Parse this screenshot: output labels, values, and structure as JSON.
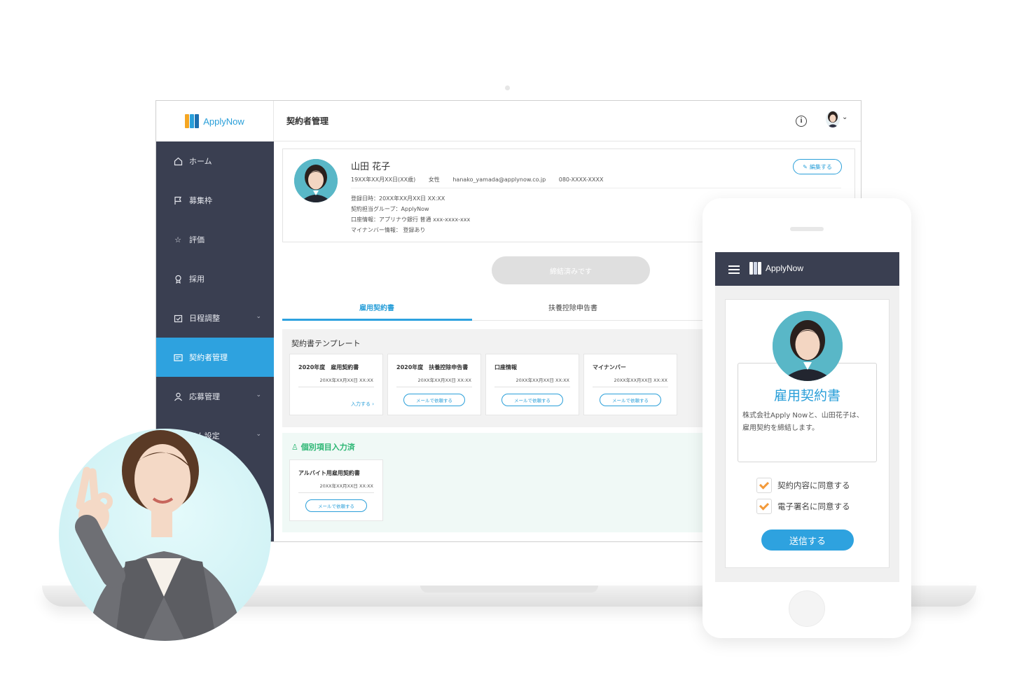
{
  "colors": {
    "accent": "#2ea2df",
    "sidebar": "#3a3f51",
    "success": "#2bb673",
    "check": "#f39a3a"
  },
  "app": {
    "brand": "ApplyNow",
    "page_title": "契約者管理"
  },
  "sidebar": {
    "items": [
      {
        "label": "ホーム",
        "icon": "home-icon"
      },
      {
        "label": "募集枠",
        "icon": "flag-icon"
      },
      {
        "label": "評価",
        "icon": "star-icon"
      },
      {
        "label": "採用",
        "icon": "ribbon-icon"
      },
      {
        "label": "日程調整",
        "icon": "calendar-icon"
      },
      {
        "label": "契約者管理",
        "icon": "id-card-icon"
      },
      {
        "label": "応募管理",
        "icon": "person-icon"
      },
      {
        "label": "テム設定",
        "icon": "settings-icon"
      }
    ]
  },
  "profile": {
    "name": "山田 花子",
    "birth": "19XX年XX月XX日(XX歳)",
    "gender": "女性",
    "email": "hanako_yamada@applynow.co.jp",
    "phone": "080-XXXX-XXXX",
    "registered": "登録日時：20XX年XX月XX日 XX:XX",
    "group": "契約担当グループ：ApplyNow",
    "bank": "口座情報：アプリナウ銀行 普通 xxx-xxxx-xxx",
    "mynumber": "マイナンバー情報： 登録あり",
    "edit_label": "編集する"
  },
  "status_button": "締結済みです",
  "tabs": [
    {
      "label": "雇用契約書"
    },
    {
      "label": "扶養控除申告書"
    }
  ],
  "templates": {
    "title": "契約書テンプレート",
    "cards": [
      {
        "title": "2020年度　雇用契約書",
        "date": "20XX年XX月XX日 XX:XX",
        "action": "入力する ›"
      },
      {
        "title": "2020年度　扶養控除申告書",
        "date": "20XX年XX月XX日 XX:XX",
        "action": "メールで依頼する"
      },
      {
        "title": "口座情報",
        "date": "20XX年XX月XX日 XX:XX",
        "action": "メールで依頼する"
      },
      {
        "title": "マイナンバー",
        "date": "20XX年XX月XX日 XX:XX",
        "action": "メールで依頼する"
      }
    ]
  },
  "individual": {
    "title": "個別項目入力済",
    "card": {
      "title": "アルバイト用雇用契約書",
      "date": "20XX年XX月XX日 XX:XX",
      "action": "メールで依頼する"
    }
  },
  "phone": {
    "brand": "ApplyNow",
    "title": "雇用契約書",
    "description": "株式会社Apply Nowと、山田花子は、雇用契約を締結します。",
    "checks": [
      "契約内容に同意する",
      "電子署名に同意する"
    ],
    "send": "送信する"
  }
}
